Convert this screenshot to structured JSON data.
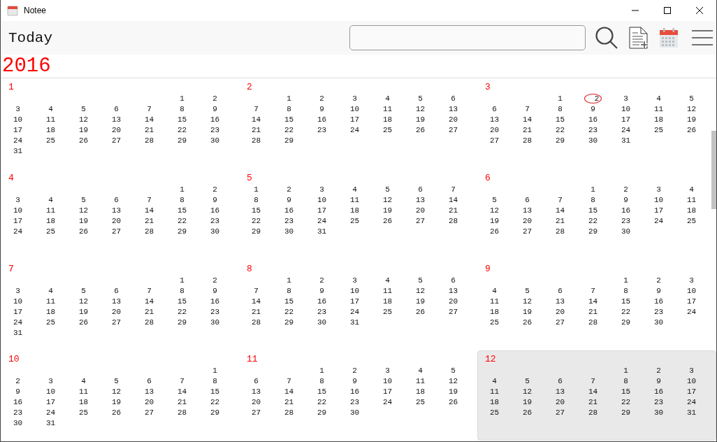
{
  "window": {
    "title": "Notee"
  },
  "toolbar": {
    "today_label": "Today"
  },
  "year": "2016",
  "months": [
    {
      "label": "1",
      "highlighted": false,
      "weeks": [
        [
          "1",
          "2"
        ],
        [
          "3",
          "4",
          "5",
          "6",
          "7",
          "8",
          "9"
        ],
        [
          "10",
          "11",
          "12",
          "13",
          "14",
          "15",
          "16"
        ],
        [
          "17",
          "18",
          "19",
          "20",
          "21",
          "22",
          "23"
        ],
        [
          "24",
          "25",
          "26",
          "27",
          "28",
          "29",
          "30"
        ],
        [
          "31"
        ]
      ]
    },
    {
      "label": "2",
      "highlighted": false,
      "weeks": [
        [
          "1",
          "2",
          "3",
          "4",
          "5",
          "6"
        ],
        [
          "7",
          "8",
          "9",
          "10",
          "11",
          "12",
          "13"
        ],
        [
          "14",
          "15",
          "16",
          "17",
          "18",
          "19",
          "20"
        ],
        [
          "21",
          "22",
          "23",
          "24",
          "25",
          "26",
          "27"
        ],
        [
          "28",
          "29"
        ]
      ]
    },
    {
      "label": "3",
      "highlighted": false,
      "weeks": [
        [
          "1",
          {
            "day": "2",
            "today": true
          },
          "3",
          "4",
          "5"
        ],
        [
          "6",
          "7",
          "8",
          "9",
          "10",
          "11",
          "12"
        ],
        [
          "13",
          "14",
          "15",
          "16",
          "17",
          "18",
          "19"
        ],
        [
          "20",
          "21",
          "22",
          "23",
          "24",
          "25",
          "26"
        ],
        [
          "27",
          "28",
          "29",
          "30",
          "31"
        ]
      ]
    },
    {
      "label": "4",
      "highlighted": false,
      "weeks": [
        [
          "1",
          "2"
        ],
        [
          "3",
          "4",
          "5",
          "6",
          "7",
          "8",
          "9"
        ],
        [
          "10",
          "11",
          "12",
          "13",
          "14",
          "15",
          "16"
        ],
        [
          "17",
          "18",
          "19",
          "20",
          "21",
          "22",
          "23"
        ],
        [
          "24",
          "25",
          "26",
          "27",
          "28",
          "29",
          "30"
        ]
      ]
    },
    {
      "label": "5",
      "highlighted": false,
      "weeks": [
        [
          "1",
          "2",
          "3",
          "4",
          "5",
          "6",
          "7"
        ],
        [
          "8",
          "9",
          "10",
          "11",
          "12",
          "13",
          "14"
        ],
        [
          "15",
          "16",
          "17",
          "18",
          "19",
          "20",
          "21"
        ],
        [
          "22",
          "23",
          "24",
          "25",
          "26",
          "27",
          "28"
        ],
        [
          "29",
          "30",
          "31"
        ]
      ]
    },
    {
      "label": "6",
      "highlighted": false,
      "weeks": [
        [
          "1",
          "2",
          "3",
          "4"
        ],
        [
          "5",
          "6",
          "7",
          "8",
          "9",
          "10",
          "11"
        ],
        [
          "12",
          "13",
          "14",
          "15",
          "16",
          "17",
          "18"
        ],
        [
          "19",
          "20",
          "21",
          "22",
          "23",
          "24",
          "25"
        ],
        [
          "26",
          "27",
          "28",
          "29",
          "30"
        ]
      ]
    },
    {
      "label": "7",
      "highlighted": false,
      "weeks": [
        [
          "1",
          "2"
        ],
        [
          "3",
          "4",
          "5",
          "6",
          "7",
          "8",
          "9"
        ],
        [
          "10",
          "11",
          "12",
          "13",
          "14",
          "15",
          "16"
        ],
        [
          "17",
          "18",
          "19",
          "20",
          "21",
          "22",
          "23"
        ],
        [
          "24",
          "25",
          "26",
          "27",
          "28",
          "29",
          "30"
        ],
        [
          "31"
        ]
      ]
    },
    {
      "label": "8",
      "highlighted": false,
      "weeks": [
        [
          "1",
          "2",
          "3",
          "4",
          "5",
          "6"
        ],
        [
          "7",
          "8",
          "9",
          "10",
          "11",
          "12",
          "13"
        ],
        [
          "14",
          "15",
          "16",
          "17",
          "18",
          "19",
          "20"
        ],
        [
          "21",
          "22",
          "23",
          "24",
          "25",
          "26",
          "27"
        ],
        [
          "28",
          "29",
          "30",
          "31"
        ]
      ]
    },
    {
      "label": "9",
      "highlighted": false,
      "weeks": [
        [
          "1",
          "2",
          "3"
        ],
        [
          "4",
          "5",
          "6",
          "7",
          "8",
          "9",
          "10"
        ],
        [
          "11",
          "12",
          "13",
          "14",
          "15",
          "16",
          "17"
        ],
        [
          "18",
          "19",
          "20",
          "21",
          "22",
          "23",
          "24"
        ],
        [
          "25",
          "26",
          "27",
          "28",
          "29",
          "30"
        ]
      ]
    },
    {
      "label": "10",
      "highlighted": false,
      "weeks": [
        [
          "1"
        ],
        [
          "2",
          "3",
          "4",
          "5",
          "6",
          "7",
          "8"
        ],
        [
          "9",
          "10",
          "11",
          "12",
          "13",
          "14",
          "15"
        ],
        [
          "16",
          "17",
          "18",
          "19",
          "20",
          "21",
          "22"
        ],
        [
          "23",
          "24",
          "25",
          "26",
          "27",
          "28",
          "29"
        ],
        [
          "30",
          "31"
        ]
      ]
    },
    {
      "label": "11",
      "highlighted": false,
      "weeks": [
        [
          "1",
          "2",
          "3",
          "4",
          "5"
        ],
        [
          "6",
          "7",
          "8",
          "9",
          "10",
          "11",
          "12"
        ],
        [
          "13",
          "14",
          "15",
          "16",
          "17",
          "18",
          "19"
        ],
        [
          "20",
          "21",
          "22",
          "23",
          "24",
          "25",
          "26"
        ],
        [
          "27",
          "28",
          "29",
          "30"
        ]
      ]
    },
    {
      "label": "12",
      "highlighted": true,
      "weeks": [
        [
          "1",
          "2",
          "3"
        ],
        [
          "4",
          "5",
          "6",
          "7",
          "8",
          "9",
          "10"
        ],
        [
          "11",
          "12",
          "13",
          "14",
          "15",
          "16",
          "17"
        ],
        [
          "18",
          "19",
          "20",
          "21",
          "22",
          "23",
          "24"
        ],
        [
          "25",
          "26",
          "27",
          "28",
          "29",
          "30",
          "31"
        ]
      ]
    }
  ]
}
